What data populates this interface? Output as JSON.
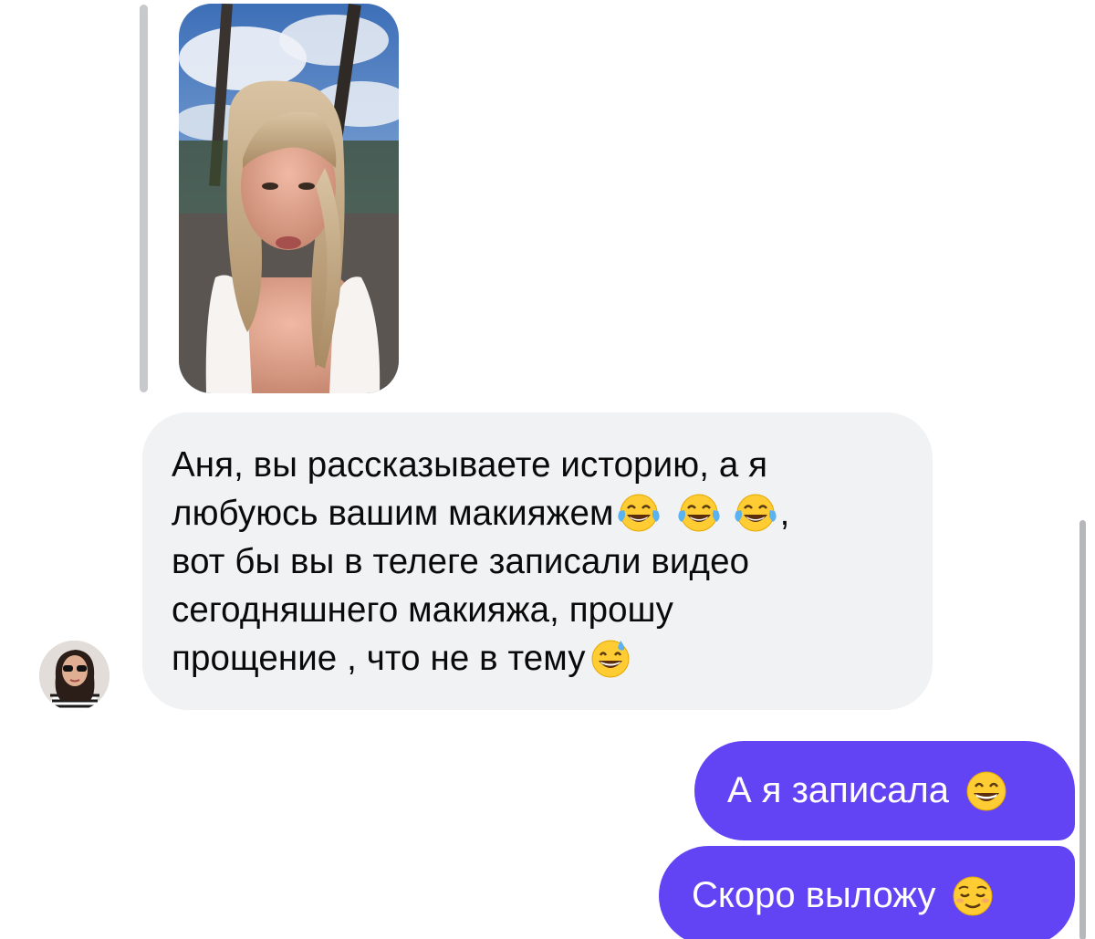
{
  "conversation": {
    "story_reply": {
      "thumbnail_icon": "story-video-thumbnail"
    },
    "incoming_message": {
      "line1": "Аня, вы рассказываете историю, а я",
      "line2_text": "любуюсь вашим макияжем",
      "line2_emojis": [
        "face-with-tears-of-joy",
        "face-with-tears-of-joy",
        "face-with-tears-of-joy"
      ],
      "line2_tail": ",",
      "line3": "вот бы вы в телеге записали видео",
      "line4": "сегодняшнего макияжа, прошу",
      "line5_text": "прощение , что не в тему",
      "line5_emoji": "grinning-face-with-sweat",
      "sender_avatar_icon": "avatar"
    },
    "outgoing_messages": [
      {
        "text": "А я записала",
        "emoji": "grinning-face-with-smiling-eyes"
      },
      {
        "text": "Скоро выложу",
        "emoji": "relieved-face"
      }
    ]
  },
  "colors": {
    "outgoing_bubble": "#6344f5",
    "incoming_bubble": "#f1f2f4",
    "reply_bar": "#c8c9cd"
  }
}
